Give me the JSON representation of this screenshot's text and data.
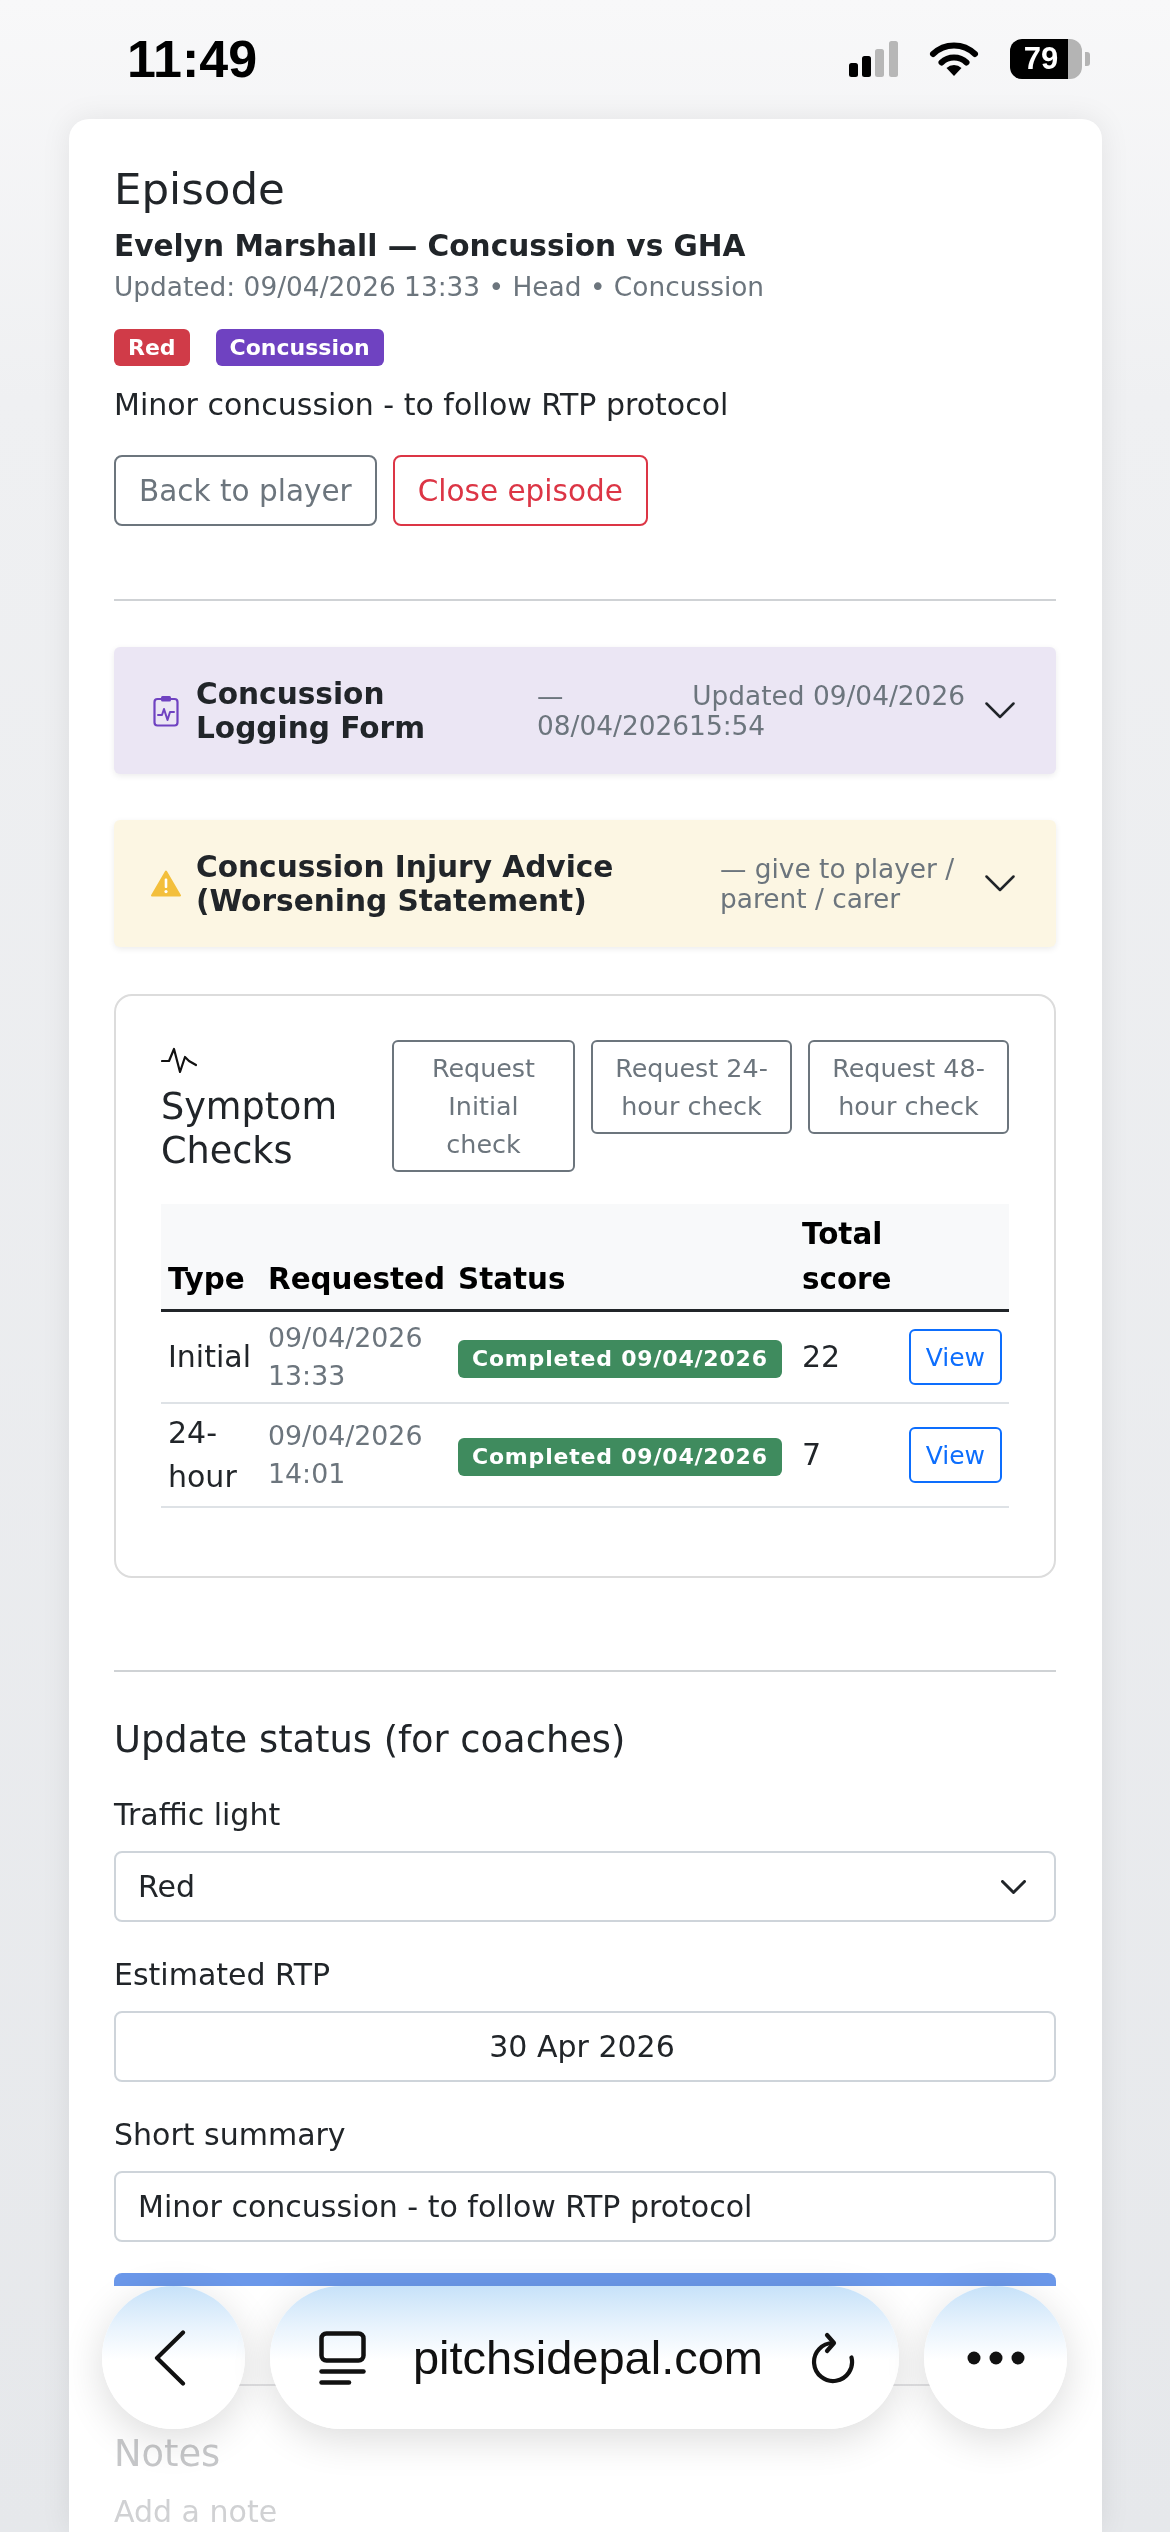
{
  "status_bar": {
    "time": "11:49",
    "battery": "79"
  },
  "episode": {
    "heading": "Episode",
    "title": "Evelyn Marshall — Concussion vs GHA",
    "meta": "Updated: 09/04/2026 13:33 • Head • Concussion",
    "badges": [
      {
        "label": "Red",
        "color": "#d03b48"
      },
      {
        "label": "Concussion",
        "color": "#6f42c1"
      }
    ],
    "summary": "Minor concussion - to follow RTP protocol",
    "actions": [
      {
        "label": "Back to player",
        "kind": "secondary"
      },
      {
        "label": "Close episode",
        "kind": "danger"
      }
    ]
  },
  "panels": [
    {
      "kind": "form",
      "title": "Concussion Logging Form",
      "date_prefix": "—",
      "updated": "Updated 09/04/2026",
      "date": "08/04/202615:54",
      "expanded": false
    },
    {
      "kind": "advice",
      "title": "Concussion Injury Advice (Worsening Statement)",
      "note": "— give to player / parent / carer",
      "expanded": false
    }
  ],
  "symptom_checks": {
    "title": "Symptom Checks",
    "requests": [
      "Request Initial check",
      "Request 24-hour check",
      "Request 48-hour check"
    ],
    "table": {
      "columns": [
        "Type",
        "Requested",
        "Status",
        "Total score"
      ],
      "rows": [
        {
          "type": "Initial",
          "requested": "09/04/2026 13:33",
          "status": "Completed 09/04/2026",
          "total_score": "22",
          "action": "View"
        },
        {
          "type": "24-hour",
          "requested": "09/04/2026 14:01",
          "status": "Completed 09/04/2026",
          "total_score": "7",
          "action": "View"
        }
      ]
    }
  },
  "update_status": {
    "heading": "Update status (for coaches)",
    "fields": [
      {
        "kind": "select",
        "label": "Traffic light",
        "value": "Red"
      },
      {
        "kind": "date",
        "label": "Estimated RTP",
        "value": "30 Apr 2026"
      },
      {
        "kind": "text",
        "label": "Short summary",
        "value": "Minor concussion - to follow RTP protocol"
      }
    ],
    "submit_button": {
      "kind": "primary"
    }
  },
  "notes": {
    "heading": "Notes",
    "placeholder": "Add a note"
  },
  "browser_bar": {
    "url": "pitchsidepal.com"
  }
}
